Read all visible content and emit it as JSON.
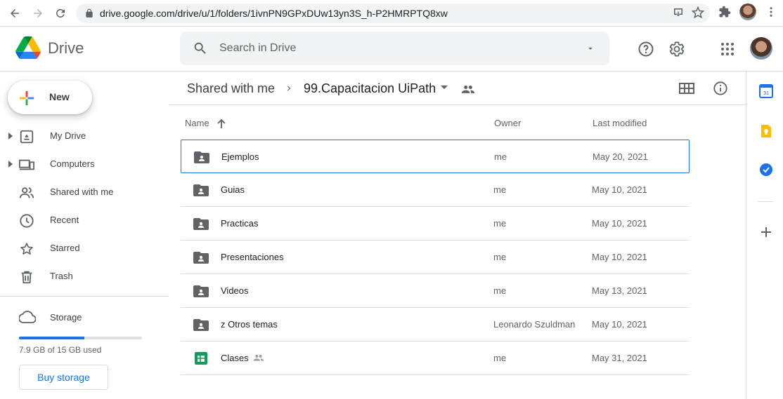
{
  "browser": {
    "url": "drive.google.com/drive/u/1/folders/1ivnPN9GPxDUw13yn3S_h-P2HMRPTQ8xw"
  },
  "header": {
    "app_name": "Drive",
    "search_placeholder": "Search in Drive"
  },
  "sidebar": {
    "new_label": "New",
    "items": [
      {
        "label": "My Drive",
        "icon": "my-drive-icon"
      },
      {
        "label": "Computers",
        "icon": "computers-icon"
      },
      {
        "label": "Shared with me",
        "icon": "people-icon"
      },
      {
        "label": "Recent",
        "icon": "clock-icon"
      },
      {
        "label": "Starred",
        "icon": "star-icon"
      },
      {
        "label": "Trash",
        "icon": "trash-icon"
      }
    ],
    "storage": {
      "label": "Storage",
      "usage_text": "7.9 GB of 15 GB used",
      "used_fraction": 0.53,
      "buy_label": "Buy storage"
    }
  },
  "breadcrumb": {
    "root": "Shared with me",
    "current": "99.Capacitacion UiPath"
  },
  "table": {
    "columns": {
      "name": "Name",
      "owner": "Owner",
      "modified": "Last modified"
    },
    "rows": [
      {
        "name": "Ejemplos",
        "owner": "me",
        "modified": "May 20, 2021",
        "type": "shared-folder"
      },
      {
        "name": "Guias",
        "owner": "me",
        "modified": "May 10, 2021",
        "type": "shared-folder"
      },
      {
        "name": "Practicas",
        "owner": "me",
        "modified": "May 10, 2021",
        "type": "shared-folder"
      },
      {
        "name": "Presentaciones",
        "owner": "me",
        "modified": "May 10, 2021",
        "type": "shared-folder"
      },
      {
        "name": "Videos",
        "owner": "me",
        "modified": "May 13, 2021",
        "type": "shared-folder"
      },
      {
        "name": "z Otros temas",
        "owner": "Leonardo Szuldman",
        "modified": "May 10, 2021",
        "type": "shared-folder"
      },
      {
        "name": "Clases",
        "owner": "me",
        "modified": "May 31, 2021",
        "type": "spreadsheet"
      }
    ]
  },
  "colors": {
    "accent": "#1a73e8",
    "icon_grey": "#5f6368",
    "sheets_green": "#0f9d58"
  }
}
